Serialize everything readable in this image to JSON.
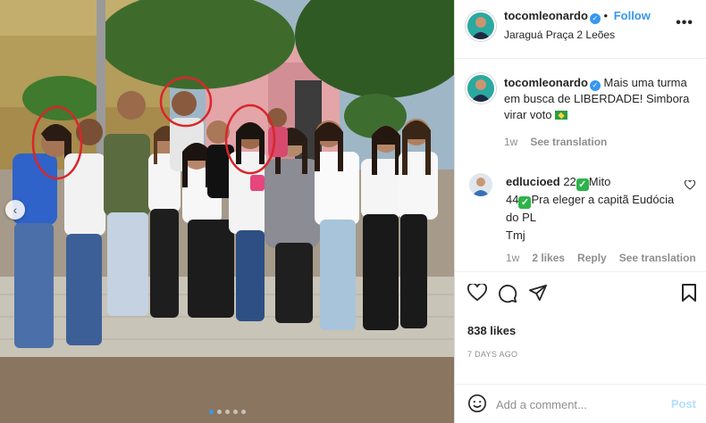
{
  "post": {
    "username": "tocomleonardo",
    "follow_label": "Follow",
    "location": "Jaraguá Praça 2 Leões",
    "more_label": "•••",
    "caption": {
      "text": "Mais uma turma em busca de LIBERDADE! Simbora virar voto",
      "time": "1w",
      "see_translation": "See translation"
    },
    "comment": {
      "username": "edlucioed",
      "line1_a": "22",
      "line1_b": "Mito",
      "line2_a": "44",
      "line2_b": "Pra eleger a capitã Eudócia do PL",
      "line3": "Tmj",
      "time": "1w",
      "likes": "2 likes",
      "reply": "Reply",
      "see_translation": "See translation"
    },
    "likes": "838 likes",
    "date": "7 DAYS AGO",
    "add_comment_placeholder": "Add a comment...",
    "post_label": "Post",
    "carousel": {
      "slides": 5,
      "active": 0
    }
  },
  "colors": {
    "accent": "#3897f0",
    "muted": "#8e8e8e",
    "post_disabled": "#b2dffc",
    "highlight_circle": "#d9262b"
  },
  "icons": [
    "verified-icon",
    "more-icon",
    "heart-icon",
    "comment-icon",
    "share-icon",
    "bookmark-icon",
    "emoji-icon",
    "chevron-left-icon",
    "check-emoji-icon",
    "brazil-flag-icon"
  ]
}
